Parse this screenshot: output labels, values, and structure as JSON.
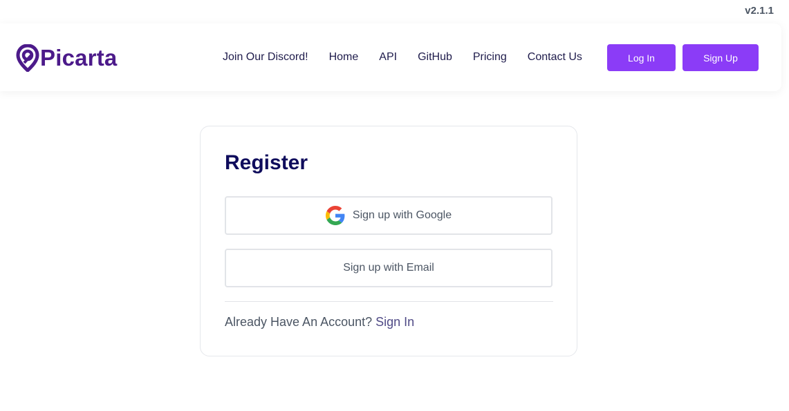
{
  "version": "v2.1.1",
  "brand": {
    "name": "Picarta",
    "icon": "map-pin-logo-icon",
    "color": "#4c1a8a"
  },
  "nav": {
    "links": [
      {
        "label": "Join Our Discord!",
        "name": "nav-link-discord"
      },
      {
        "label": "Home",
        "name": "nav-link-home"
      },
      {
        "label": "API",
        "name": "nav-link-api"
      },
      {
        "label": "GitHub",
        "name": "nav-link-github"
      },
      {
        "label": "Pricing",
        "name": "nav-link-pricing"
      },
      {
        "label": "Contact Us",
        "name": "nav-link-contact"
      }
    ],
    "login_label": "Log In",
    "signup_label": "Sign Up",
    "accent_color": "#8b3cf7"
  },
  "register": {
    "title": "Register",
    "google_label": "Sign up with Google",
    "google_icon": "google-icon",
    "email_label": "Sign up with Email",
    "already_text": "Already Have An Account?",
    "signin_label": "Sign In"
  }
}
